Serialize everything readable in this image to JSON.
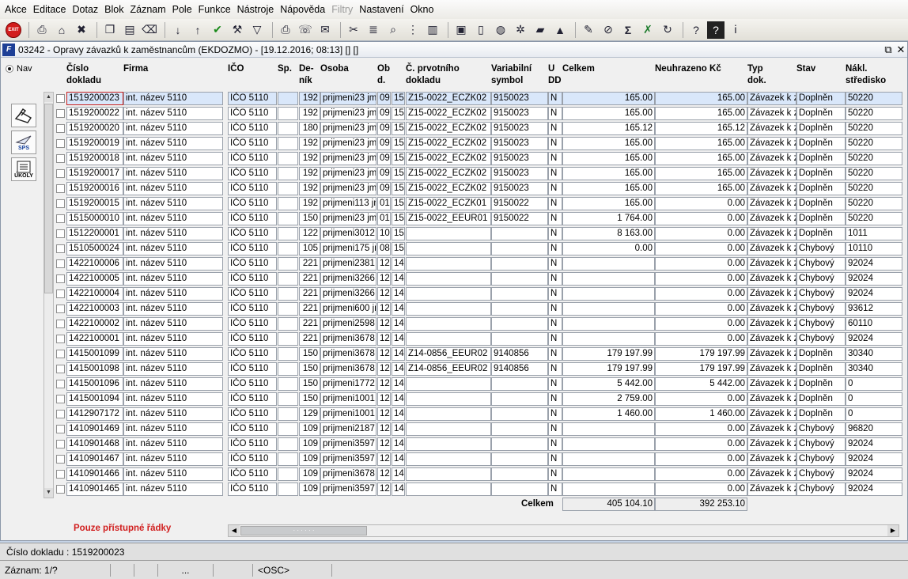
{
  "menu": [
    "Akce",
    "Editace",
    "Dotaz",
    "Blok",
    "Záznam",
    "Pole",
    "Funkce",
    "Nástroje",
    "Nápověda",
    "Filtry",
    "Nastavení",
    "Okno"
  ],
  "menu_disabled": [
    "Filtry"
  ],
  "toolbar": {
    "exit_label": "EXIT",
    "icons": [
      "print-icon",
      "home-icon",
      "delete-icon",
      "copy-icon",
      "paste-icon",
      "clear-icon",
      "sort-asc-icon",
      "sort-desc-icon",
      "check-icon",
      "wrench-icon",
      "filter-icon",
      "printer-icon",
      "fax-icon",
      "mail-icon",
      "cut-icon",
      "list-icon",
      "search-icon",
      "tree-icon",
      "columns-icon",
      "clipboard-icon",
      "document-icon",
      "globe-icon",
      "settings-icon",
      "chart-icon",
      "mountain-icon",
      "edit-icon",
      "no-icon",
      "sigma-icon",
      "excel-icon",
      "refresh-icon",
      "help-icon",
      "help-book-icon",
      "info-icon"
    ]
  },
  "window": {
    "title": "03242 - Opravy závazků k zaměstnancům (EKDOZMO) - [19.12.2016; 08:13] [] []",
    "restore": "⧉",
    "close": "✕"
  },
  "nav_label": "Nav",
  "side_buttons": [
    {
      "name": "edit-hand-button",
      "label": ""
    },
    {
      "name": "sps-button",
      "label": "SPS"
    },
    {
      "name": "ukoly-button",
      "label": "ÚKOLY"
    }
  ],
  "headers": [
    "Číslo\ndokladu",
    "Firma",
    "IČO",
    "Sp.",
    "De-\nník",
    "Osoba",
    "Ob\nd.",
    "Č. prvotního\ndokladu",
    "Variabilní\nsymbol",
    "U\nDD",
    "Celkem",
    "Neuhrazeno Kč",
    "Typ\ndok.",
    "Stav",
    "Nákl.\nstředisko"
  ],
  "rows": [
    [
      "1519200023",
      "int. název 5110",
      "IČO 5110",
      "",
      "192",
      "prijmeni23 jme",
      "09",
      "15",
      "Z15-0022_ECZK02",
      "9150023",
      "N",
      "165.00",
      "165.00",
      "Závazek k z",
      "Doplněn",
      "50220"
    ],
    [
      "1519200022",
      "int. název 5110",
      "IČO 5110",
      "",
      "192",
      "prijmeni23 jme",
      "09",
      "15",
      "Z15-0022_ECZK02",
      "9150023",
      "N",
      "165.00",
      "165.00",
      "Závazek k z",
      "Doplněn",
      "50220"
    ],
    [
      "1519200020",
      "int. název 5110",
      "IČO 5110",
      "",
      "180",
      "prijmeni23 jme",
      "09",
      "15",
      "Z15-0022_ECZK02",
      "9150023",
      "N",
      "165.12",
      "165.12",
      "Závazek k z",
      "Doplněn",
      "50220"
    ],
    [
      "1519200019",
      "int. název 5110",
      "IČO 5110",
      "",
      "192",
      "prijmeni23 jme",
      "09",
      "15",
      "Z15-0022_ECZK02",
      "9150023",
      "N",
      "165.00",
      "165.00",
      "Závazek k z",
      "Doplněn",
      "50220"
    ],
    [
      "1519200018",
      "int. název 5110",
      "IČO 5110",
      "",
      "192",
      "prijmeni23 jme",
      "09",
      "15",
      "Z15-0022_ECZK02",
      "9150023",
      "N",
      "165.00",
      "165.00",
      "Závazek k z",
      "Doplněn",
      "50220"
    ],
    [
      "1519200017",
      "int. název 5110",
      "IČO 5110",
      "",
      "192",
      "prijmeni23 jme",
      "09",
      "15",
      "Z15-0022_ECZK02",
      "9150023",
      "N",
      "165.00",
      "165.00",
      "Závazek k z",
      "Doplněn",
      "50220"
    ],
    [
      "1519200016",
      "int. název 5110",
      "IČO 5110",
      "",
      "192",
      "prijmeni23 jme",
      "09",
      "15",
      "Z15-0022_ECZK02",
      "9150023",
      "N",
      "165.00",
      "165.00",
      "Závazek k z",
      "Doplněn",
      "50220"
    ],
    [
      "1519200015",
      "int. název 5110",
      "IČO 5110",
      "",
      "192",
      "prijmeni113 jm",
      "01",
      "15",
      "Z15-0022_ECZK01",
      "9150022",
      "N",
      "165.00",
      "0.00",
      "Závazek k z",
      "Doplněn",
      "50220"
    ],
    [
      "1515000010",
      "int. název 5110",
      "IČO 5110",
      "",
      "150",
      "prijmeni23 jme",
      "01",
      "15",
      "Z15-0022_EEUR01",
      "9150022",
      "N",
      "1 764.00",
      "0.00",
      "Závazek k z",
      "Doplněn",
      "50220"
    ],
    [
      "1512200001",
      "int. název 5110",
      "IČO 5110",
      "",
      "122",
      "prijmeni3012 ji",
      "10",
      "15",
      "",
      "",
      "N",
      "8 163.00",
      "0.00",
      "Závazek k z",
      "Doplněn",
      "1011"
    ],
    [
      "1510500024",
      "int. název 5110",
      "IČO 5110",
      "",
      "105",
      "prijmeni175 jm",
      "08",
      "15",
      "",
      "",
      "N",
      "0.00",
      "0.00",
      "Závazek k z",
      "Chybový",
      "10110"
    ],
    [
      "1422100006",
      "int. název 5110",
      "IČO 5110",
      "",
      "221",
      "prijmeni2381 ji",
      "12",
      "14",
      "",
      "",
      "N",
      "",
      "0.00",
      "Závazek k z",
      "Chybový",
      "92024"
    ],
    [
      "1422100005",
      "int. název 5110",
      "IČO 5110",
      "",
      "221",
      "prijmeni3266 ji",
      "12",
      "14",
      "",
      "",
      "N",
      "",
      "0.00",
      "Závazek k z",
      "Chybový",
      "92024"
    ],
    [
      "1422100004",
      "int. název 5110",
      "IČO 5110",
      "",
      "221",
      "prijmeni3266 ji",
      "12",
      "14",
      "",
      "",
      "N",
      "",
      "0.00",
      "Závazek k z",
      "Chybový",
      "92024"
    ],
    [
      "1422100003",
      "int. název 5110",
      "IČO 5110",
      "",
      "221",
      "prijmeni600 jm",
      "12",
      "14",
      "",
      "",
      "N",
      "",
      "0.00",
      "Závazek k z",
      "Chybový",
      "93612"
    ],
    [
      "1422100002",
      "int. název 5110",
      "IČO 5110",
      "",
      "221",
      "prijmeni2598 ji",
      "12",
      "14",
      "",
      "",
      "N",
      "",
      "0.00",
      "Závazek k z",
      "Chybový",
      "60110"
    ],
    [
      "1422100001",
      "int. název 5110",
      "IČO 5110",
      "",
      "221",
      "prijmeni3678 ji",
      "12",
      "14",
      "",
      "",
      "N",
      "",
      "0.00",
      "Závazek k z",
      "Chybový",
      "92024"
    ],
    [
      "1415001099",
      "int. název 5110",
      "IČO 5110",
      "",
      "150",
      "prijmeni3678 ji",
      "12",
      "14",
      "Z14-0856_EEUR02",
      "9140856",
      "N",
      "179 197.99",
      "179 197.99",
      "Závazek k z",
      "Doplněn",
      "30340"
    ],
    [
      "1415001098",
      "int. název 5110",
      "IČO 5110",
      "",
      "150",
      "prijmeni3678 ji",
      "12",
      "14",
      "Z14-0856_EEUR02",
      "9140856",
      "N",
      "179 197.99",
      "179 197.99",
      "Závazek k z",
      "Doplněn",
      "30340"
    ],
    [
      "1415001096",
      "int. název 5110",
      "IČO 5110",
      "",
      "150",
      "prijmeni1772 ji",
      "12",
      "14",
      "",
      "",
      "N",
      "5 442.00",
      "5 442.00",
      "Závazek k z",
      "Doplněn",
      "0"
    ],
    [
      "1415001094",
      "int. název 5110",
      "IČO 5110",
      "",
      "150",
      "prijmeni1001 ji",
      "12",
      "14",
      "",
      "",
      "N",
      "2 759.00",
      "0.00",
      "Závazek k z",
      "Doplněn",
      "0"
    ],
    [
      "1412907172",
      "int. název 5110",
      "IČO 5110",
      "",
      "129",
      "prijmeni1001 ji",
      "12",
      "14",
      "",
      "",
      "N",
      "1 460.00",
      "1 460.00",
      "Závazek k z",
      "Doplněn",
      "0"
    ],
    [
      "1410901469",
      "int. název 5110",
      "IČO 5110",
      "",
      "109",
      "prijmeni2187 ji",
      "12",
      "14",
      "",
      "",
      "N",
      "",
      "0.00",
      "Závazek k z",
      "Chybový",
      "96820"
    ],
    [
      "1410901468",
      "int. název 5110",
      "IČO 5110",
      "",
      "109",
      "prijmeni3597 ji",
      "12",
      "14",
      "",
      "",
      "N",
      "",
      "0.00",
      "Závazek k z",
      "Chybový",
      "92024"
    ],
    [
      "1410901467",
      "int. název 5110",
      "IČO 5110",
      "",
      "109",
      "prijmeni3597 ji",
      "12",
      "14",
      "",
      "",
      "N",
      "",
      "0.00",
      "Závazek k z",
      "Chybový",
      "92024"
    ],
    [
      "1410901466",
      "int. název 5110",
      "IČO 5110",
      "",
      "109",
      "prijmeni3678 ji",
      "12",
      "14",
      "",
      "",
      "N",
      "",
      "0.00",
      "Závazek k z",
      "Chybový",
      "92024"
    ],
    [
      "1410901465",
      "int. název 5110",
      "IČO 5110",
      "",
      "109",
      "prijmeni3597 ji",
      "12",
      "14",
      "",
      "",
      "N",
      "",
      "0.00",
      "Závazek k z",
      "Chybový",
      "92024"
    ]
  ],
  "totals": {
    "label": "Celkem",
    "celkem": "405 104.10",
    "neuhrazeno": "392 253.10"
  },
  "pouze": "Pouze přístupné řádky",
  "status": {
    "line1": "Číslo dokladu : 1519200023",
    "zaznam": "Záznam: 1/?",
    "ellipsis": "...",
    "osc": "<OSC>"
  }
}
